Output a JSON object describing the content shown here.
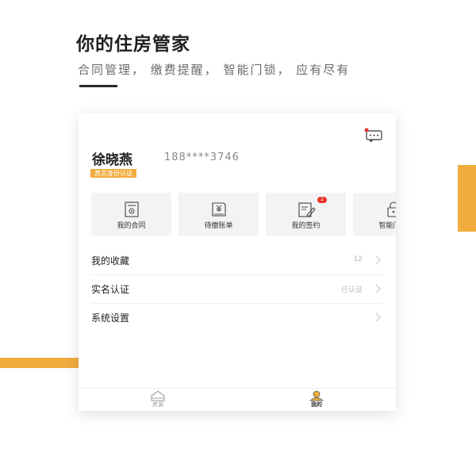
{
  "hero": {
    "title": "你的住房管家",
    "subtitle": "合同管理， 缴费提醒， 智能门锁， 应有尽有"
  },
  "header": {
    "message_icon": "chat-bubble-icon"
  },
  "user": {
    "name": "徐晓燕",
    "phone": "188****3746",
    "verify_badge": "真实身份认证"
  },
  "shortcuts": [
    {
      "label": "我的合同",
      "icon": "contract-icon"
    },
    {
      "label": "待缴账单",
      "icon": "bill-icon"
    },
    {
      "label": "我的签约",
      "icon": "sign-icon",
      "badge": "2"
    },
    {
      "label": "智能门锁",
      "icon": "smart-lock-icon"
    }
  ],
  "menu": [
    {
      "label": "我的收藏",
      "value": "12"
    },
    {
      "label": "实名认证",
      "value": "已认证"
    },
    {
      "label": "系统设置",
      "value": ""
    }
  ],
  "tabbar": [
    {
      "label": "房源",
      "icon": "house-icon",
      "active": false
    },
    {
      "label": "我的",
      "icon": "profile-icon",
      "active": true
    }
  ],
  "colors": {
    "accent": "#f0ad3e",
    "badge": "#e8342c",
    "text": "#1f1f1f"
  }
}
